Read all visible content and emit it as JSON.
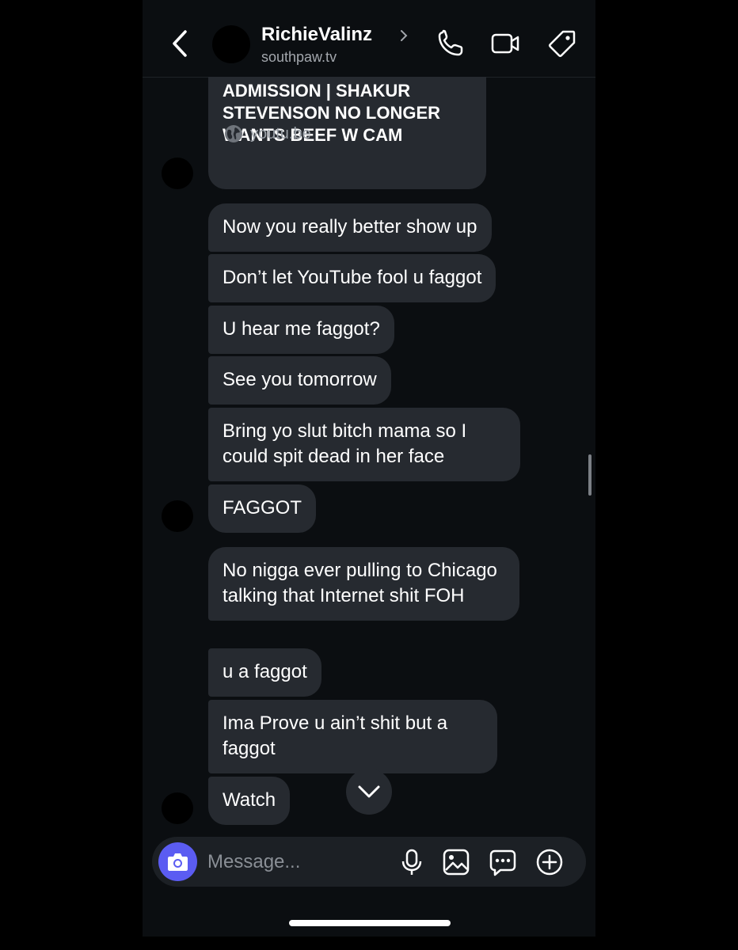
{
  "header": {
    "name": "RichieValinz",
    "subtitle": "southpaw.tv",
    "icons": [
      "back-icon",
      "chevron-right-icon",
      "phone-icon",
      "video-icon",
      "tag-icon"
    ]
  },
  "link_card": {
    "title": "ADMISSION | SHAKUR STEVENSON NO LONGER WANTS BEEF W CAM",
    "domain": "youtu.be",
    "icon": "globe-icon"
  },
  "messages": [
    "Now you really better show up",
    "Don’t let YouTube fool u faggot",
    "U hear me faggot?",
    "See you tomorrow",
    "Bring yo slut bitch mama so I could spit dead in her face",
    "FAGGOT",
    "No nigga ever pulling to Chicago talking that Internet shit FOH",
    "u a faggot",
    "Ima Prove u ain’t shit but a faggot",
    "Watch"
  ],
  "composer": {
    "placeholder": "Message...",
    "icons": [
      "camera-icon",
      "microphone-icon",
      "image-icon",
      "sticker-icon",
      "plus-icon"
    ]
  },
  "colors": {
    "background": "#0b0e11",
    "bubble": "#262a30",
    "camera_button": "#5b5cf2"
  }
}
